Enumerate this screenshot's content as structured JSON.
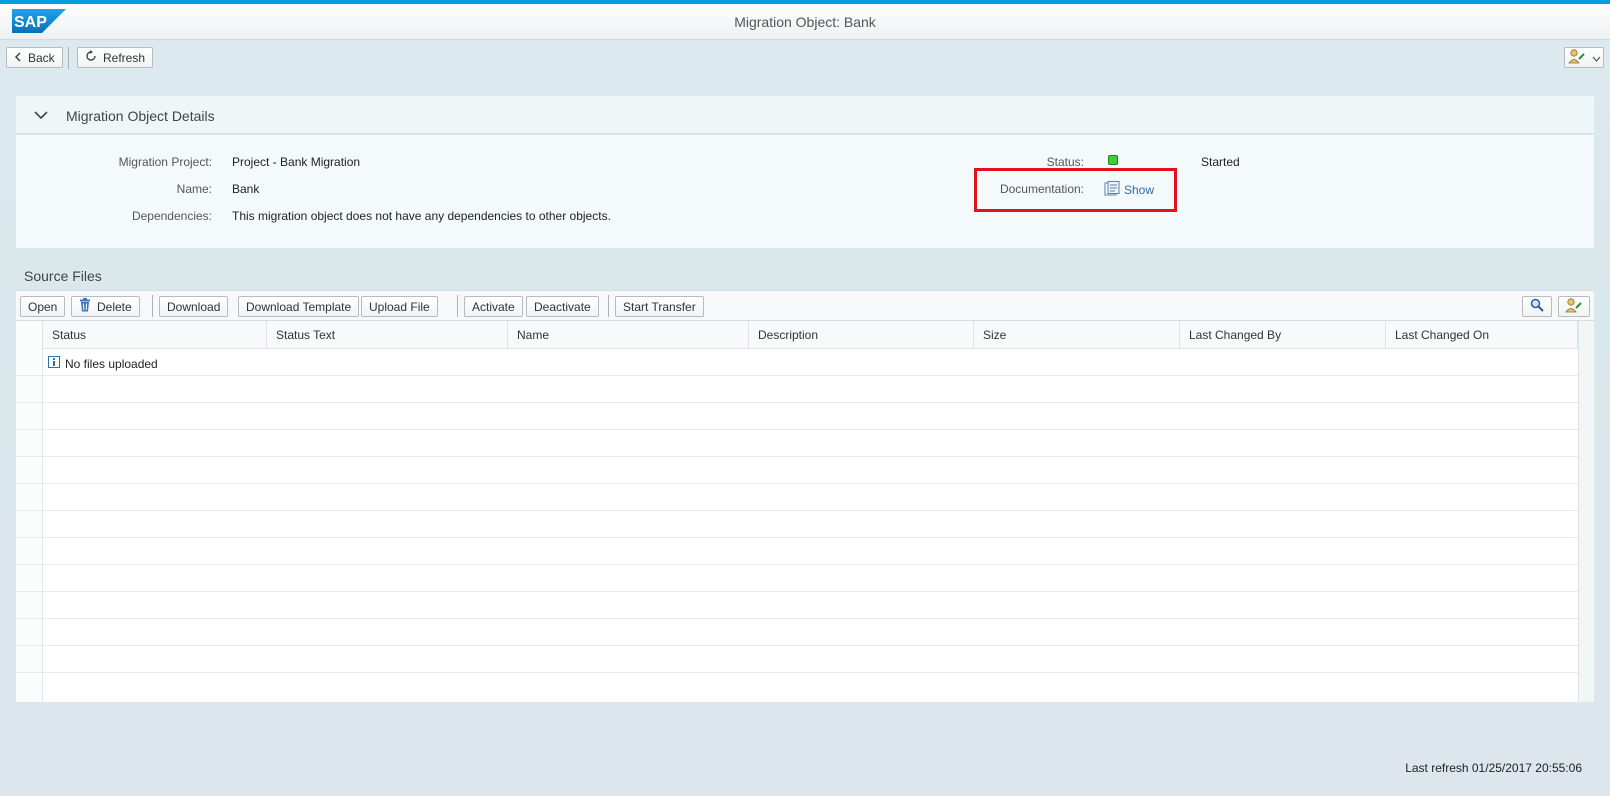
{
  "shell": {
    "logo_text": "SAP",
    "title": "Migration Object: Bank"
  },
  "toolbar": {
    "back_label": "Back",
    "refresh_label": "Refresh"
  },
  "details": {
    "header_title": "Migration Object Details",
    "migration_project_label": "Migration Project:",
    "migration_project_value": "Project - Bank Migration",
    "name_label": "Name:",
    "name_value": "Bank",
    "dependencies_label": "Dependencies:",
    "dependencies_value": "This migration object does not have any dependencies to other objects.",
    "status_label": "Status:",
    "status_value": "Started",
    "status_color": "#3ad13a",
    "documentation_label": "Documentation:",
    "documentation_link": "Show"
  },
  "source_files": {
    "title": "Source Files",
    "buttons": {
      "open": "Open",
      "delete": "Delete",
      "download": "Download",
      "download_template": "Download Template",
      "upload_file": "Upload File",
      "activate": "Activate",
      "deactivate": "Deactivate",
      "start_transfer": "Start Transfer"
    },
    "columns": [
      "Status",
      "Status Text",
      "Name",
      "Description",
      "Size",
      "Last Changed By",
      "Last Changed On"
    ],
    "empty_message": "No files uploaded"
  },
  "footer": {
    "last_refresh": "Last refresh 01/25/2017 20:55:06"
  },
  "colors": {
    "accent": "#009de0",
    "link": "#2a6cb0",
    "highlight": "#e2121d"
  }
}
